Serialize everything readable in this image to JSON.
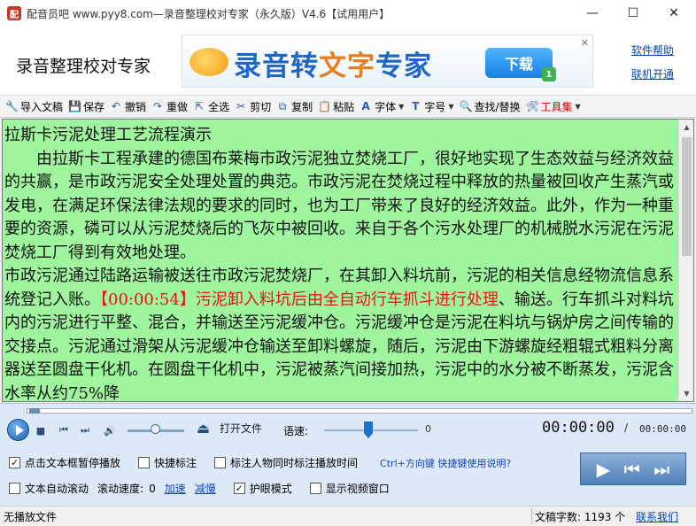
{
  "window": {
    "title": "配音员吧 www.pyy8.com—录音整理校对专家（永久版）V4.6【试用用户】",
    "app_icon": "app-logo-icon",
    "minimize": "—",
    "maximize": "☐",
    "close": "✕"
  },
  "header": {
    "app_name": "录音整理校对专家",
    "banner_title_a": "录音转",
    "banner_title_b": "文字",
    "banner_title_c": "专家",
    "banner_download": "下载",
    "banner_badge": "1",
    "banner_close": "✕",
    "links": [
      "软件帮助",
      "联机开通"
    ]
  },
  "toolbar": {
    "items": [
      {
        "label": "导入文稿",
        "icon": "import-icon"
      },
      {
        "label": "保存",
        "icon": "save-icon"
      },
      {
        "label": "撤销",
        "icon": "undo-icon"
      },
      {
        "label": "重做",
        "icon": "redo-icon"
      },
      {
        "label": "全选",
        "icon": "select-all-icon"
      },
      {
        "label": "剪切",
        "icon": "cut-icon"
      },
      {
        "label": "复制",
        "icon": "copy-icon"
      },
      {
        "label": "粘贴",
        "icon": "paste-icon"
      },
      {
        "label": "字体",
        "icon": "font-icon"
      },
      {
        "label": "字号",
        "icon": "font-size-icon"
      },
      {
        "label": "查找/替换",
        "icon": "find-replace-icon"
      },
      {
        "label": "工具集",
        "icon": "tools-icon"
      }
    ]
  },
  "editor": {
    "title_line": "拉斯卡污泥处理工艺流程演示",
    "para1": "由拉斯卡工程承建的德国布莱梅市政污泥独立焚烧工厂，很好地实现了生态效益与经济效益的共赢，是市政污泥安全处理处置的典范。市政污泥在焚烧过程中释放的热量被回收产生蒸汽或发电，在满足环保法律法规的要求的同时，也为工厂带来了良好的经济效益。此外，作为一种重要的资源，磷可以从污泥焚烧后的飞灰中被回收。来自于各个污水处理厂的机械脱水污泥在污泥焚烧工厂得到有效地处理。",
    "para2_before": "市政污泥通过陆路运输被送往市政污泥焚烧厂，在其卸入料坑前，污泥的相关信息经物流信息系统登记入账。",
    "para2_marked": "【00:00:54】污泥卸入料坑后由全自动行车抓斗进行处理",
    "para2_after": "、输送。行车抓斗对料坑内的污泥进行平整、混合，并输送至污泥缓冲仓。污泥缓冲仓是污泥在料坑与锅炉房之间传输的交接点。污泥通过滑架从污泥缓冲仓输送至卸料螺旋，随后，污泥由下游螺旋经粗辊式粗料分离器送至圆盘干化机。在圆盘干化机中，污泥被蒸汽间接加热，污泥中的水分被不断蒸发，污泥含水率从约75%降"
  },
  "player": {
    "open_file": "打开文件",
    "speed_label": "语速:",
    "speed_value": "0",
    "time_current": "00:00:00",
    "time_sep": "/",
    "time_total": "00:00:00",
    "options_row1": [
      {
        "label": "点击文本框暂停播放",
        "checked": true
      },
      {
        "label": "快捷标注",
        "checked": false
      },
      {
        "label": "标注人物同时标注播放时间",
        "checked": false
      }
    ],
    "hint": "Ctrl+方向键 快捷键使用说明?",
    "auto_scroll": {
      "label": "文本自动滚动",
      "checked": false
    },
    "scroll_speed_label": "滚动速度:",
    "scroll_speed_value": "0",
    "speed_up": "加速",
    "slow_down": "减慢",
    "eye_mode": {
      "label": "护眼模式",
      "checked": true
    },
    "show_video": {
      "label": "显示视频窗口",
      "checked": false
    },
    "check_mark": "✓",
    "big_controls": [
      "▶",
      "⏮",
      "⏭"
    ]
  },
  "status": {
    "left": "无播放文件",
    "count": "文稿字数: 1193 个",
    "link": "联系我们"
  }
}
